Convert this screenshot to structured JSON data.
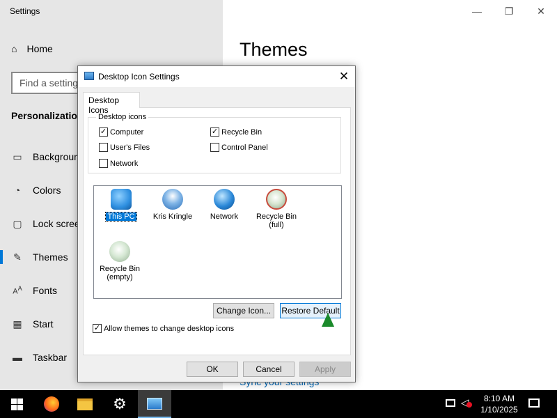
{
  "settings": {
    "window_title": "Settings",
    "controls": {
      "minimize": "—",
      "restore": "❐",
      "close": "✕"
    },
    "home": {
      "icon": "home-icon",
      "label": "Home"
    },
    "search": {
      "placeholder": "Find a setting"
    },
    "section_title": "Personalization",
    "nav": [
      {
        "icon": "picture-icon",
        "label": "Background"
      },
      {
        "icon": "palette-icon",
        "label": "Colors"
      },
      {
        "icon": "lockscreen-icon",
        "label": "Lock screen"
      },
      {
        "icon": "brush-icon",
        "label": "Themes"
      },
      {
        "icon": "font-icon",
        "label": "Fonts"
      },
      {
        "icon": "start-icon",
        "label": "Start"
      },
      {
        "icon": "taskbar-icon",
        "label": "Taskbar"
      }
    ],
    "page_title": "Themes",
    "sync_link": "Sync your settings"
  },
  "dialog": {
    "title": "Desktop Icon Settings",
    "close": "✕",
    "tab": "Desktop Icons",
    "group_label": "Desktop icons",
    "checkboxes": [
      {
        "label": "Computer",
        "checked": true
      },
      {
        "label": "Recycle Bin",
        "checked": true
      },
      {
        "label": "User's Files",
        "checked": false
      },
      {
        "label": "Control Panel",
        "checked": false
      },
      {
        "label": "Network",
        "checked": false
      }
    ],
    "icons": [
      {
        "line1": "This PC",
        "line2": "",
        "selected": true,
        "color": "#2e8fe0"
      },
      {
        "line1": "Kris Kringle",
        "line2": "",
        "selected": false,
        "color": "#3a7fc8"
      },
      {
        "line1": "Network",
        "line2": "",
        "selected": false,
        "color": "#2a88d8"
      },
      {
        "line1": "Recycle Bin",
        "line2": "(full)",
        "selected": false,
        "color": "#c9d9c4"
      },
      {
        "line1": "Recycle Bin",
        "line2": "(empty)",
        "selected": false,
        "color": "#c7dcc7"
      }
    ],
    "change_icon": "Change Icon...",
    "restore_default": "Restore Default",
    "allow_themes": {
      "label": "Allow themes to change desktop icons",
      "checked": true
    },
    "ok": "OK",
    "cancel": "Cancel",
    "apply": "Apply"
  },
  "taskbar": {
    "apps": [
      "start-icon",
      "firefox-icon",
      "file-explorer-icon",
      "settings-icon",
      "desktop-icon-settings-icon"
    ],
    "time": "8:10 AM",
    "date": "1/10/2025"
  }
}
